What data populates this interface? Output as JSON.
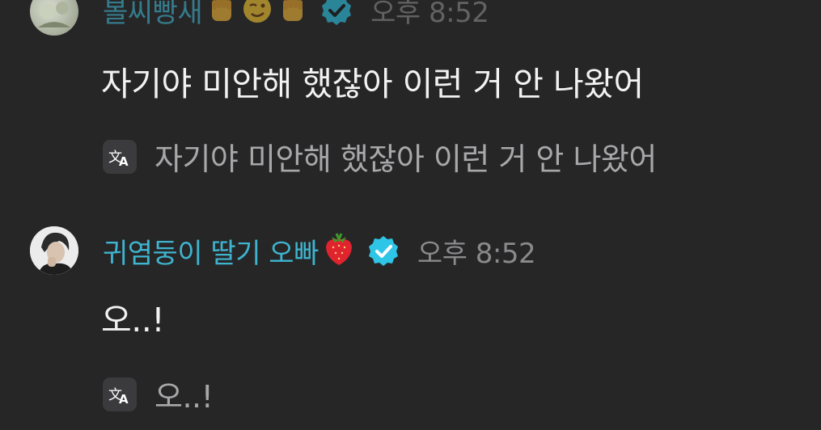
{
  "messages": [
    {
      "sender": "볼씨빵새",
      "time": "오후 8:52",
      "text": "자기야 미안해 했잖아 이런 거 안 나왔어",
      "translation": "자기야 미안해 했잖아 이런 거 안 나왔어"
    },
    {
      "sender": "귀염둥이 딸기 오빠",
      "time": "오후 8:52",
      "text": "오..!",
      "translation": "오..!"
    }
  ],
  "colors": {
    "background": "#262627",
    "username": "#3fb4cf",
    "verified_badge": "#2fc5e6",
    "time": "#8a8a8c",
    "message_text": "#f2f2f2",
    "translation_text": "#a8a8aa"
  },
  "icons": {
    "translate": "translate-icon",
    "verified": "verified-badge-icon",
    "emoji_1": "raised-fist-emoji",
    "emoji_2": "winking-face-emoji",
    "emoji_3": "raised-fist-emoji",
    "emoji_4": "strawberry-emoji"
  }
}
